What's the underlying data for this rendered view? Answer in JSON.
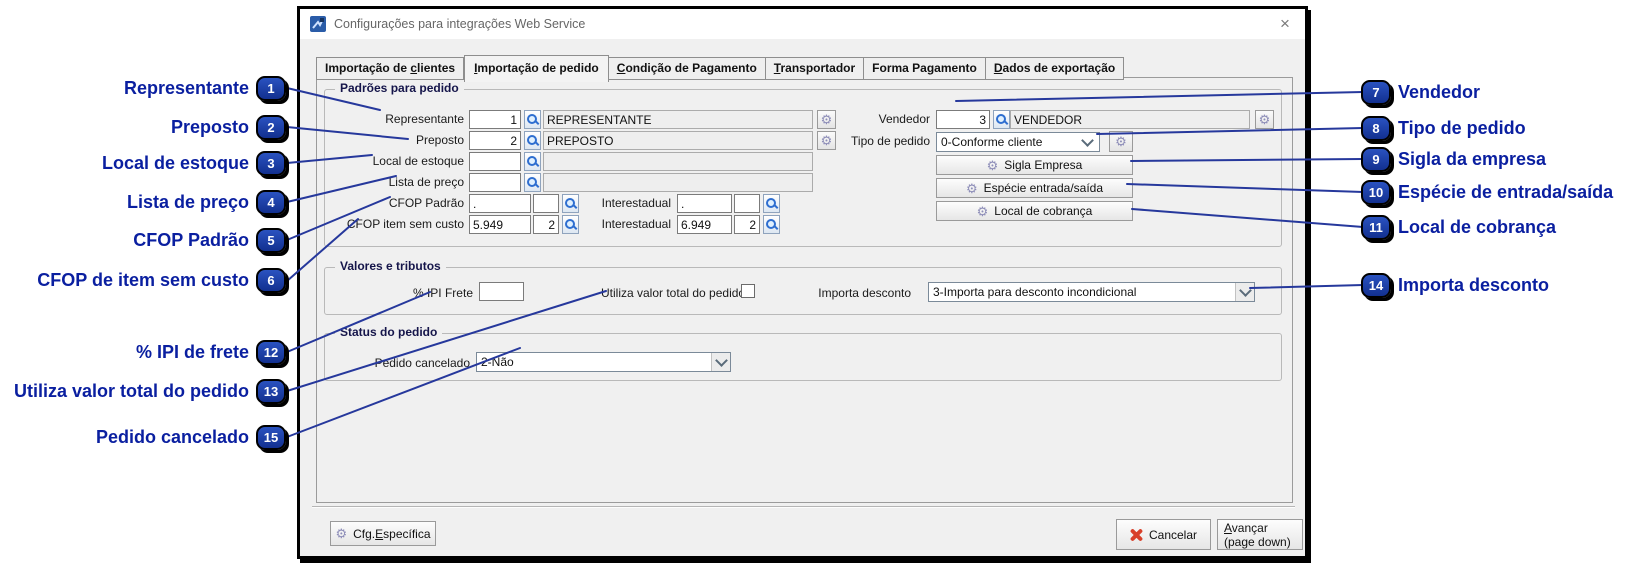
{
  "window": {
    "title": "Configurações para integrações Web Service",
    "close": "×"
  },
  "icons": {
    "gear": "⚙"
  },
  "tabs": [
    {
      "pre": "Importação de ",
      "u": "c",
      "post": "lientes"
    },
    {
      "pre": "",
      "u": "I",
      "post": "mportação de pedido"
    },
    {
      "pre": "",
      "u": "C",
      "post": "ondição de Pagamento"
    },
    {
      "pre": "",
      "u": "T",
      "post": "ransportador"
    },
    {
      "pre": "Forma Pagamento",
      "u": "",
      "post": ""
    },
    {
      "pre": "",
      "u": "D",
      "post": "ados de exportação"
    }
  ],
  "groups": {
    "padroes": {
      "title": "Padrões para pedido"
    },
    "valores": {
      "title": "Valores e tributos"
    },
    "status": {
      "title": "Status do pedido"
    }
  },
  "fields": {
    "representante": {
      "label": "Representante",
      "code": "1",
      "desc": "REPRESENTANTE"
    },
    "preposto": {
      "label": "Preposto",
      "code": "2",
      "desc": "PREPOSTO"
    },
    "local_estoque": {
      "label": "Local de estoque",
      "code": "",
      "desc": ""
    },
    "lista_preco": {
      "label": "Lista de preço",
      "code": "",
      "desc": ""
    },
    "cfop_padrao": {
      "label": "CFOP Padrão",
      "v1": ".",
      "v2": "",
      "inter_label": "Interestadual",
      "iv1": ".",
      "iv2": ""
    },
    "cfop_sem_custo": {
      "label": "CFOP item sem custo",
      "v1": "5.949",
      "v2": "2",
      "inter_label": "Interestadual",
      "iv1": "6.949",
      "iv2": "2"
    },
    "vendedor": {
      "label": "Vendedor",
      "code": "3",
      "desc": "VENDEDOR"
    },
    "tipo_pedido": {
      "label": "Tipo de pedido",
      "value": "0-Conforme cliente"
    },
    "ipi_frete": {
      "label": "% IPI Frete",
      "value": ""
    },
    "utiliza_total": {
      "label": "Utiliza valor total do pedido"
    },
    "importa_desconto": {
      "label": "Importa desconto",
      "value": "3-Importa para desconto incondicional"
    },
    "pedido_cancelado": {
      "label": "Pedido cancelado",
      "value": "2-Não"
    }
  },
  "buttons": {
    "sigla": "Sigla Empresa",
    "especie": "Espécie entrada/saída",
    "cobranca": "Local de cobrança",
    "cfg": {
      "pre": "Cfg.",
      "u": "E",
      "post": "specífica"
    },
    "cancelar": "Cancelar",
    "avancar": {
      "pre": "",
      "u": "A",
      "post": "vançar",
      "line2": "(page down)"
    }
  },
  "callouts": {
    "left": [
      {
        "n": "1",
        "label": "Representante"
      },
      {
        "n": "2",
        "label": "Preposto"
      },
      {
        "n": "3",
        "label": "Local de estoque"
      },
      {
        "n": "4",
        "label": "Lista de preço"
      },
      {
        "n": "5",
        "label": "CFOP Padrão"
      },
      {
        "n": "6",
        "label": "CFOP de item sem custo"
      },
      {
        "n": "12",
        "label": "% IPI de frete"
      },
      {
        "n": "13",
        "label": "Utiliza valor total do pedido"
      },
      {
        "n": "15",
        "label": "Pedido cancelado"
      }
    ],
    "right": [
      {
        "n": "7",
        "label": "Vendedor"
      },
      {
        "n": "8",
        "label": "Tipo de pedido"
      },
      {
        "n": "9",
        "label": "Sigla da empresa"
      },
      {
        "n": "10",
        "label": "Espécie de entrada/saída"
      },
      {
        "n": "11",
        "label": "Local de cobrança"
      },
      {
        "n": "14",
        "label": "Importa desconto"
      }
    ]
  },
  "colors": {
    "accent_blue": "#0a1fa0",
    "badge_blue": "#17379f",
    "line_blue": "#26389c",
    "cancel_red": "#d8402a",
    "advance_green": "#3db528"
  }
}
